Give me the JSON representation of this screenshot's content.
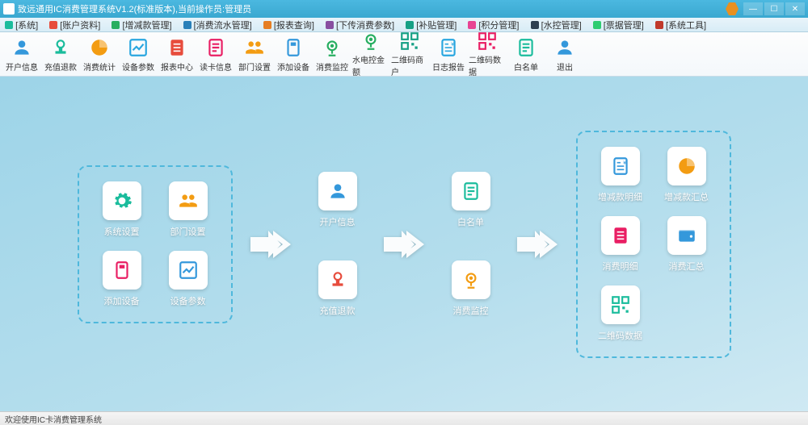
{
  "window": {
    "title": "致远通用IC消费管理系统V1.2(标准版本),当前操作员:管理员"
  },
  "menu": [
    {
      "icon": "#1abc9c",
      "label": "[系统]"
    },
    {
      "icon": "#e74c3c",
      "label": "[账户资料]"
    },
    {
      "icon": "#27ae60",
      "label": "[增减款管理]"
    },
    {
      "icon": "#2980b9",
      "label": "[消费流水管理]"
    },
    {
      "icon": "#e67e22",
      "label": "[报表查询]"
    },
    {
      "icon": "#884ea0",
      "label": "[下传消费参数]"
    },
    {
      "icon": "#16a085",
      "label": "[补贴管理]"
    },
    {
      "icon": "#e84393",
      "label": "[积分管理]"
    },
    {
      "icon": "#2c3e50",
      "label": "[水控管理]"
    },
    {
      "icon": "#2ecc71",
      "label": "[票据管理]"
    },
    {
      "icon": "#c0392b",
      "label": "[系统工具]"
    }
  ],
  "toolbar": [
    {
      "key": "open-info",
      "label": "开户信息"
    },
    {
      "key": "recharge",
      "label": "充值退款"
    },
    {
      "key": "consume",
      "label": "消费统计"
    },
    {
      "key": "dev-param",
      "label": "设备参数"
    },
    {
      "key": "report",
      "label": "报表中心"
    },
    {
      "key": "card",
      "label": "读卡信息"
    },
    {
      "key": "dept",
      "label": "部门设置"
    },
    {
      "key": "add-dev",
      "label": "添加设备"
    },
    {
      "key": "monitor",
      "label": "消费监控"
    },
    {
      "key": "water",
      "label": "水电控金额"
    },
    {
      "key": "qr-vend",
      "label": "二维码商户"
    },
    {
      "key": "log",
      "label": "日志报告"
    },
    {
      "key": "qr-data",
      "label": "二维码数据"
    },
    {
      "key": "whitelist",
      "label": "白名单"
    },
    {
      "key": "exit",
      "label": "退出"
    }
  ],
  "panels": {
    "left": [
      {
        "id": "sys-set",
        "label": "系统设置",
        "color": "#1abc9c",
        "icon": "gear"
      },
      {
        "id": "dept-set",
        "label": "部门设置",
        "color": "#f39c12",
        "icon": "group"
      },
      {
        "id": "add-dev",
        "label": "添加设备",
        "color": "#e91e63",
        "icon": "device"
      },
      {
        "id": "dev-param",
        "label": "设备参数",
        "color": "#3498db",
        "icon": "chart"
      }
    ],
    "mid1": [
      {
        "id": "open-info",
        "label": "开户信息",
        "color": "#3498db",
        "icon": "user"
      },
      {
        "id": "recharge",
        "label": "充值退款",
        "color": "#e74c3c",
        "icon": "stamp"
      }
    ],
    "mid2": [
      {
        "id": "whitelist",
        "label": "白名单",
        "color": "#1abc9c",
        "icon": "list"
      },
      {
        "id": "monitor",
        "label": "消费监控",
        "color": "#f39c12",
        "icon": "cam"
      }
    ],
    "right": [
      {
        "id": "inc-detail",
        "label": "增减款明细",
        "color": "#3498db",
        "icon": "receipt"
      },
      {
        "id": "inc-sum",
        "label": "增减款汇总",
        "color": "#f39c12",
        "icon": "pie"
      },
      {
        "id": "cons-detail",
        "label": "消费明细",
        "color": "#e91e63",
        "icon": "sheet"
      },
      {
        "id": "cons-sum",
        "label": "消费汇总",
        "color": "#3498db",
        "icon": "wallet"
      },
      {
        "id": "qr-data",
        "label": "二维码数据",
        "color": "#1abc9c",
        "icon": "qr"
      }
    ]
  },
  "statusbar": {
    "text": "欢迎使用IC卡消费管理系统"
  }
}
